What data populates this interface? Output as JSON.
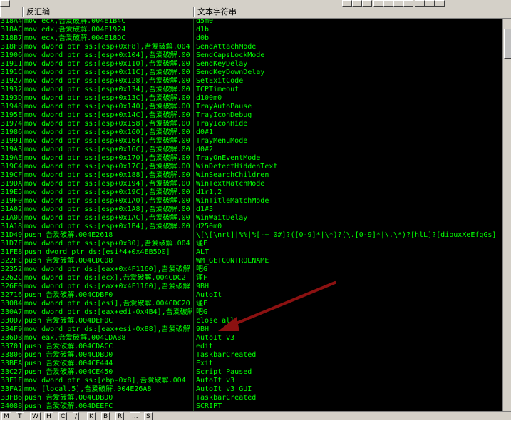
{
  "header": {
    "col_disasm": "反汇编",
    "col_strings": "文本字符串"
  },
  "rows": [
    {
      "addr": "318A4",
      "dis": "mov ecx,吾爱破解.004E1B4C",
      "str": "d5m0"
    },
    {
      "addr": "318AC",
      "dis": "mov edx,吾爱破解.004E1924",
      "str": "d1b"
    },
    {
      "addr": "318B7",
      "dis": "mov ecx,吾爱破解.004E18DC",
      "str": "d0b"
    },
    {
      "addr": "318FB",
      "dis": "mov dword ptr ss:[esp+0xF8],吾爱破解.004",
      "str": "SendAttachMode"
    },
    {
      "addr": "31906",
      "dis": "mov dword ptr ss:[esp+0x104],吾爱破解.00",
      "str": "SendCapsLockMode"
    },
    {
      "addr": "31911",
      "dis": "mov dword ptr ss:[esp+0x110],吾爱破解.00",
      "str": "SendKeyDelay"
    },
    {
      "addr": "3191C",
      "dis": "mov dword ptr ss:[esp+0x11C],吾爱破解.00",
      "str": "SendKeyDownDelay"
    },
    {
      "addr": "31927",
      "dis": "mov dword ptr ss:[esp+0x128],吾爱破解.00",
      "str": "SetExitCode"
    },
    {
      "addr": "31932",
      "dis": "mov dword ptr ss:[esp+0x134],吾爱破解.00",
      "str": "TCPTimeout"
    },
    {
      "addr": "3193D",
      "dis": "mov dword ptr ss:[esp+0x13C],吾爱破解.00",
      "str": "d100m0"
    },
    {
      "addr": "31948",
      "dis": "mov dword ptr ss:[esp+0x140],吾爱破解.00",
      "str": "TrayAutoPause"
    },
    {
      "addr": "3195E",
      "dis": "mov dword ptr ss:[esp+0x14C],吾爱破解.00",
      "str": "TrayIconDebug"
    },
    {
      "addr": "31974",
      "dis": "mov dword ptr ss:[esp+0x158],吾爱破解.00",
      "str": "TrayIconHide"
    },
    {
      "addr": "31986",
      "dis": "mov dword ptr ss:[esp+0x160],吾爱破解.00",
      "str": "d0#1"
    },
    {
      "addr": "31991",
      "dis": "mov dword ptr ss:[esp+0x164],吾爱破解.00",
      "str": "TrayMenuMode"
    },
    {
      "addr": "319A3",
      "dis": "mov dword ptr ss:[esp+0x16C],吾爱破解.00",
      "str": "d0#2"
    },
    {
      "addr": "319AE",
      "dis": "mov dword ptr ss:[esp+0x170],吾爱破解.00",
      "str": "TrayOnEventMode"
    },
    {
      "addr": "319C4",
      "dis": "mov dword ptr ss:[esp+0x17C],吾爱破解.00",
      "str": "WinDetectHiddenText"
    },
    {
      "addr": "319CF",
      "dis": "mov dword ptr ss:[esp+0x188],吾爱破解.00",
      "str": "WinSearchChildren"
    },
    {
      "addr": "319DA",
      "dis": "mov dword ptr ss:[esp+0x194],吾爱破解.00",
      "str": "WinTextMatchMode"
    },
    {
      "addr": "319E5",
      "dis": "mov dword ptr ss:[esp+0x19C],吾爱破解.00",
      "str": "d1r1,2"
    },
    {
      "addr": "319F0",
      "dis": "mov dword ptr ss:[esp+0x1A0],吾爱破解.00",
      "str": "WinTitleMatchMode"
    },
    {
      "addr": "31A02",
      "dis": "mov dword ptr ss:[esp+0x1A8],吾爱破解.00",
      "str": "d1#3"
    },
    {
      "addr": "31A0D",
      "dis": "mov dword ptr ss:[esp+0x1AC],吾爱破解.00",
      "str": "WinWaitDelay"
    },
    {
      "addr": "31A18",
      "dis": "mov dword ptr ss:[esp+0x1B4],吾爱破解.00",
      "str": "d250m0"
    },
    {
      "addr": "31D49",
      "dis": "push 吾爱破解.004E2618",
      "str": "\\[\\[\\nrt]|%%|%[-+ 0#]?([0-9]*|\\*)?(\\.[0-9]*|\\.\\*)?[hlL]?[diouxXeEfgGs]"
    },
    {
      "addr": "31D7F",
      "dis": "mov dword ptr ss:[esp+0x30],吾爱破解.004",
      "str": "谨F"
    },
    {
      "addr": "31FE8",
      "dis": "push dword ptr ds:[esi*4+0x4EB5D0]",
      "str": "ALT"
    },
    {
      "addr": "322FC",
      "dis": "push 吾爱破解.004CDC08",
      "str": "WM_GETCONTROLNAME"
    },
    {
      "addr": "32352",
      "dis": "mov dword ptr ds:[eax+0x4F1160],吾爱破解",
      "str": "吧G"
    },
    {
      "addr": "3262C",
      "dis": "mov dword ptr ds:[ecx],吾爱破解.004CDC2",
      "str": "谨F"
    },
    {
      "addr": "326F0",
      "dis": "mov dword ptr ds:[eax+0x4F1160],吾爱破解",
      "str": "9BH"
    },
    {
      "addr": "32716",
      "dis": "push 吾爱破解.004CDBF0",
      "str": "AutoIt"
    },
    {
      "addr": "33084",
      "dis": "mov dword ptr ds:[esi],吾爱破解.004CDC20",
      "str": "谨F"
    },
    {
      "addr": "330A7",
      "dis": "mov dword ptr ds:[eax+edi-0x4B4],吾爱破解",
      "str": "吧G"
    },
    {
      "addr": "330D7",
      "dis": "push 吾爱破解.004DEF0C",
      "str": "close all"
    },
    {
      "addr": "334F9",
      "dis": "mov dword ptr ds:[eax+esi-0x88],吾爱破解",
      "str": "9BH"
    },
    {
      "addr": "336DB",
      "dis": "mov eax,吾爱破解.004CDAB8",
      "str": "AutoIt v3"
    },
    {
      "addr": "33701",
      "dis": "push 吾爱破解.004CDACC",
      "str": "edit"
    },
    {
      "addr": "33806",
      "dis": "push 吾爱破解.004CDBD0",
      "str": "TaskbarCreated"
    },
    {
      "addr": "33BEA",
      "dis": "push 吾爱破解.004CE444",
      "str": "Exit"
    },
    {
      "addr": "33C27",
      "dis": "push 吾爱破解.004CE450",
      "str": "Script Paused"
    },
    {
      "addr": "33F1F",
      "dis": "mov dword ptr ss:[ebp-0x8],吾爱破解.004",
      "str": "AutoIt v3"
    },
    {
      "addr": "33FA2",
      "dis": "mov [local.5],吾爱破解.004E26A8",
      "str": "AutoIt v3 GUI"
    },
    {
      "addr": "33FB6",
      "dis": "push 吾爱破解.004CDBD0",
      "str": "TaskbarCreated"
    },
    {
      "addr": "34088",
      "dis": "push 吾爱破解.004DEEFC",
      "str": "SCRIPT"
    }
  ],
  "tabs": [
    "M",
    "T",
    "W",
    "H",
    "C",
    "/",
    "K",
    "B",
    "R",
    "...",
    "S"
  ],
  "colors": {
    "listing_bg": "#000000",
    "listing_text": "#00ff00",
    "arrow": "#8b1111",
    "chrome": "#d4d0c8"
  },
  "icons": [
    "scrollbar-thumb-icon",
    "annotation-arrow-icon"
  ]
}
